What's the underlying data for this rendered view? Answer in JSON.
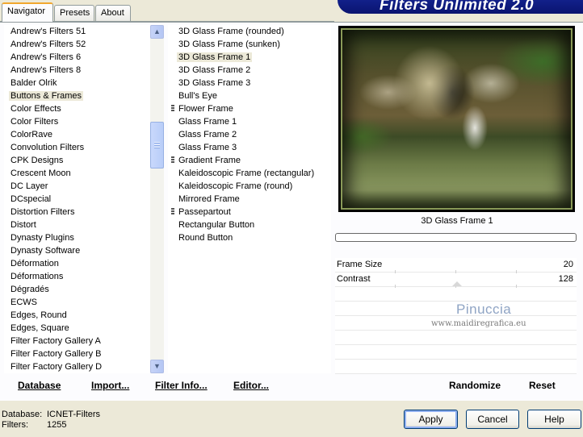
{
  "tabs": [
    {
      "label": "Navigator",
      "active": true
    },
    {
      "label": "Presets",
      "active": false
    },
    {
      "label": "About",
      "active": false
    }
  ],
  "banner": "Filters Unlimited 2.0",
  "categories": [
    "Andrew's Filters 51",
    "Andrew's Filters 52",
    "Andrew's Filters 6",
    "Andrew's Filters 8",
    "Balder Olrik",
    "Buttons & Frames",
    "Color Effects",
    "Color Filters",
    "ColorRave",
    "Convolution Filters",
    "CPK Designs",
    "Crescent Moon",
    "DC Layer",
    "DCspecial",
    "Distortion Filters",
    "Distort",
    "Dynasty Plugins",
    "Dynasty Software",
    "Déformation",
    "Déformations",
    "Dégradés",
    "ECWS",
    "Edges, Round",
    "Edges, Square",
    "Filter Factory Gallery A",
    "Filter Factory Gallery B",
    "Filter Factory Gallery D"
  ],
  "selected_category": "Buttons & Frames",
  "filters": [
    {
      "label": "3D Glass Frame (rounded)",
      "marked": false
    },
    {
      "label": "3D Glass Frame (sunken)",
      "marked": false
    },
    {
      "label": "3D Glass Frame 1",
      "marked": false
    },
    {
      "label": "3D Glass Frame 2",
      "marked": false
    },
    {
      "label": "3D Glass Frame 3",
      "marked": false
    },
    {
      "label": "Bull's Eye",
      "marked": false
    },
    {
      "label": "Flower Frame",
      "marked": true
    },
    {
      "label": "Glass Frame 1",
      "marked": false
    },
    {
      "label": "Glass Frame 2",
      "marked": false
    },
    {
      "label": "Glass Frame 3",
      "marked": false
    },
    {
      "label": "Gradient Frame",
      "marked": true
    },
    {
      "label": "Kaleidoscopic Frame (rectangular)",
      "marked": false
    },
    {
      "label": "Kaleidoscopic Frame (round)",
      "marked": false
    },
    {
      "label": "Mirrored Frame",
      "marked": false
    },
    {
      "label": "Passepartout",
      "marked": true
    },
    {
      "label": "Rectangular Button",
      "marked": false
    },
    {
      "label": "Round Button",
      "marked": false
    }
  ],
  "selected_filter": "3D Glass Frame 1",
  "preview": {
    "caption": "3D Glass Frame 1"
  },
  "params": [
    {
      "label": "Frame Size",
      "value": "20"
    },
    {
      "label": "Contrast",
      "value": "128"
    }
  ],
  "watermark": {
    "name": "Pinuccia",
    "site": "www.maidiregrafica.eu"
  },
  "bottom_links": {
    "database": "Database",
    "import": "Import...",
    "filter_info": "Filter Info...",
    "editor": "Editor...",
    "randomize": "Randomize",
    "reset": "Reset"
  },
  "status": {
    "database_label": "Database:",
    "database_value": "ICNET-Filters",
    "filters_label": "Filters:",
    "filters_value": "1255"
  },
  "buttons": {
    "apply": "Apply",
    "cancel": "Cancel",
    "help": "Help"
  }
}
